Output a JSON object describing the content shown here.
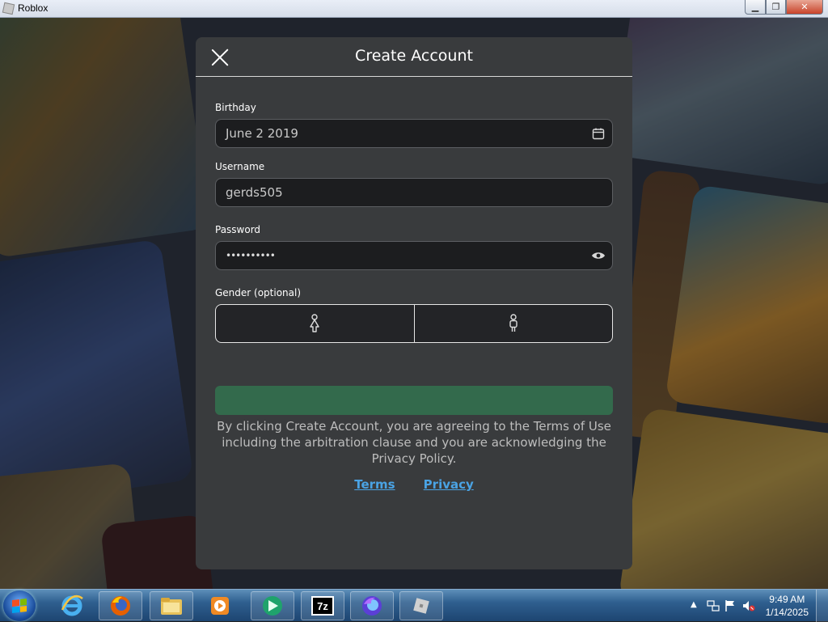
{
  "window": {
    "title": "Roblox",
    "controls": {
      "minimize": "▁",
      "maximize": "❐",
      "close": "✕"
    }
  },
  "modal": {
    "title": "Create Account",
    "close_icon": "close-icon",
    "birthday": {
      "label": "Birthday",
      "value": "June 2 2019",
      "icon": "calendar-icon"
    },
    "username": {
      "label": "Username",
      "value": "gerds505"
    },
    "password": {
      "label": "Password",
      "value": "••••••••••",
      "icon": "eye-icon"
    },
    "gender": {
      "label": "Gender (optional)",
      "options": [
        "female-icon",
        "male-icon"
      ]
    },
    "create_button_label": "",
    "legal_text": "By clicking Create Account, you are agreeing to the Terms of Use including the arbitration clause and you are acknowledging the Privacy Policy.",
    "links": {
      "terms": "Terms",
      "privacy": "Privacy"
    },
    "colors": {
      "accent_green": "#33734f",
      "link_blue": "#4aa3e4",
      "panel": "#393b3d"
    }
  },
  "taskbar": {
    "items": [
      "internet-explorer-icon",
      "firefox-icon",
      "file-explorer-icon",
      "media-player-icon",
      "app-icon",
      "7zip-icon",
      "firefox-nightly-icon",
      "roblox-icon"
    ],
    "seven_zip_label": "7z",
    "clock": {
      "time": "9:49 AM",
      "date": "1/14/2025"
    }
  }
}
